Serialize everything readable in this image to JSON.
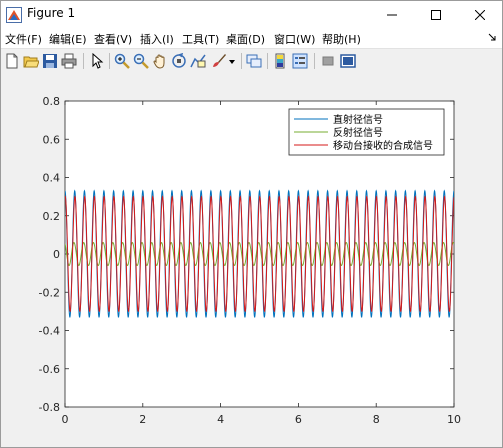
{
  "window": {
    "title": "Figure 1"
  },
  "menu": [
    "文件(F)",
    "编辑(E)",
    "查看(V)",
    "插入(I)",
    "工具(T)",
    "桌面(D)",
    "窗口(W)",
    "帮助(H)"
  ],
  "toolbar": {
    "icons": [
      "new-figure-icon",
      "open-file-icon",
      "save-icon",
      "print-icon",
      "pointer-icon",
      "zoom-in-icon",
      "zoom-out-icon",
      "pan-icon",
      "rotate-3d-icon",
      "data-cursor-icon",
      "brush-icon",
      "link-plot-icon",
      "colorbar-icon",
      "legend-icon",
      "hide-plot-tools-icon",
      "show-plot-tools-icon"
    ]
  },
  "chart_data": {
    "type": "line",
    "xlim": [
      0,
      10
    ],
    "ylim": [
      -0.8,
      0.8
    ],
    "xticks": [
      0,
      2,
      4,
      6,
      8,
      10
    ],
    "yticks": [
      -0.8,
      -0.6,
      -0.4,
      -0.2,
      0,
      0.2,
      0.4,
      0.6,
      0.8
    ],
    "xtick_labels": [
      "0",
      "2",
      "4",
      "6",
      "8",
      "10"
    ],
    "ytick_labels": [
      "-0.8",
      "-0.6",
      "-0.4",
      "-0.2",
      "0",
      "0.2",
      "0.4",
      "0.6",
      "0.8"
    ],
    "grid": false,
    "legend_position": "top-right",
    "series": [
      {
        "name": "直射径信号",
        "color": "#0072bd",
        "amplitude": 0.33,
        "frequency": 4,
        "phase": 0
      },
      {
        "name": "反射径信号",
        "color": "#77ac30",
        "amplitude": 0.06,
        "frequency": 4,
        "phase": 0.5
      },
      {
        "name": "移动台接收的合成信号",
        "color": "#d41a1a",
        "amplitude": 0.3,
        "frequency": 4,
        "phase": -0.15
      }
    ]
  }
}
